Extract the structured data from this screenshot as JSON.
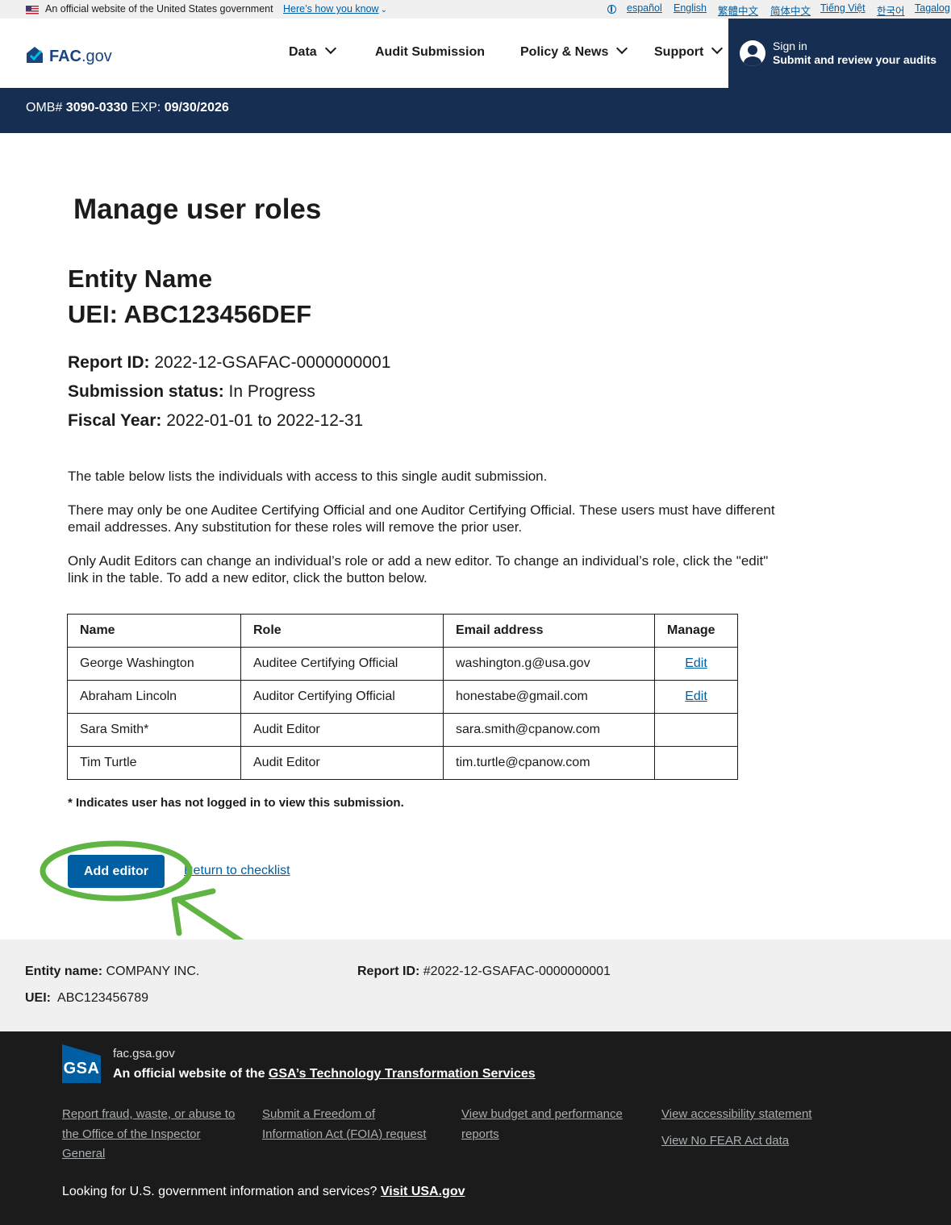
{
  "gov_banner": {
    "official_text": "An official website of the United States government",
    "how_link": "Here’s how you know",
    "languages": [
      "español",
      "English",
      "繁體中文",
      "简体中文",
      "Tiếng Việt",
      "한국어",
      "Tagalog"
    ]
  },
  "header": {
    "logo_bold": "FAC",
    "logo_suffix": ".gov",
    "nav": [
      {
        "label": "Data",
        "has_menu": true
      },
      {
        "label": "Audit Submission",
        "has_menu": false
      },
      {
        "label": "Policy & News",
        "has_menu": true
      },
      {
        "label": "Support",
        "has_menu": true
      }
    ],
    "signin_line1": "Sign in",
    "signin_line2": "Submit and review your audits"
  },
  "omb": {
    "omb_label": "OMB#",
    "omb_number": "3090-0330",
    "exp_label": "EXP:",
    "exp_date": "09/30/2026"
  },
  "main": {
    "title": "Manage user roles",
    "entity_name": "Entity Name",
    "uei_line": "UEI: ABC123456DEF",
    "report_id_label": "Report ID:",
    "report_id_value": "2022-12-GSAFAC-0000000001",
    "status_label": "Submission status:",
    "status_value": "In Progress",
    "fiscal_label": "Fiscal Year:",
    "fiscal_value": "2022-01-01 to 2022-12-31",
    "para1": "The table below lists the individuals with access to this single audit submission.",
    "para2": "There may only be one Auditee Certifying Official and one Auditor Certifying Official. These users must have different email addresses. Any substitution for these roles will remove the prior user.",
    "para3": "Only Audit Editors can change an individual’s role or add a new editor. To change an individual’s role, click the \"edit\" link in the table. To add a new editor, click the button below.",
    "table": {
      "headers": [
        "Name",
        "Role",
        "Email address",
        "Manage"
      ],
      "rows": [
        {
          "name": "George Washington",
          "role": "Auditee Certifying Official",
          "email": "washington.g@usa.gov",
          "manage": "Edit"
        },
        {
          "name": "Abraham Lincoln",
          "role": "Auditor Certifying Official",
          "email": "honestabe@gmail.com",
          "manage": "Edit"
        },
        {
          "name": "Sara Smith*",
          "role": "Audit Editor",
          "email": "sara.smith@cpanow.com",
          "manage": ""
        },
        {
          "name": "Tim Turtle",
          "role": "Audit Editor",
          "email": "tim.turtle@cpanow.com",
          "manage": ""
        }
      ]
    },
    "footnote": "* Indicates user has not logged in to view this submission.",
    "add_editor_button": "Add editor",
    "return_link": "Return to checklist"
  },
  "info_band": {
    "entity_label": "Entity name:",
    "entity_value": "COMPANY INC.",
    "report_label": "Report ID:",
    "report_value": "#2022-12-GSAFAC-0000000001",
    "uei_label": "UEI:",
    "uei_value": "ABC123456789"
  },
  "footer": {
    "gsa_logo": "GSA",
    "domain": "fac.gsa.gov",
    "official_prefix": "An official website of the",
    "official_link": "GSA’s Technology Transformation Services",
    "links": [
      "Report fraud, waste, or abuse to the Office of the Inspector General",
      "Submit a Freedom of Information Act (FOIA) request",
      "View budget and performance reports",
      "View accessibility statement",
      "View No FEAR Act data"
    ],
    "bottom_text": "Looking for U.S. government information and services?",
    "bottom_link": "Visit USA.gov"
  },
  "colors": {
    "primary": "#005ea2",
    "navy": "#162e51",
    "footer_bg": "#1b1b1b",
    "band_bg": "#f0f0f0",
    "annotation": "#5fb443"
  }
}
